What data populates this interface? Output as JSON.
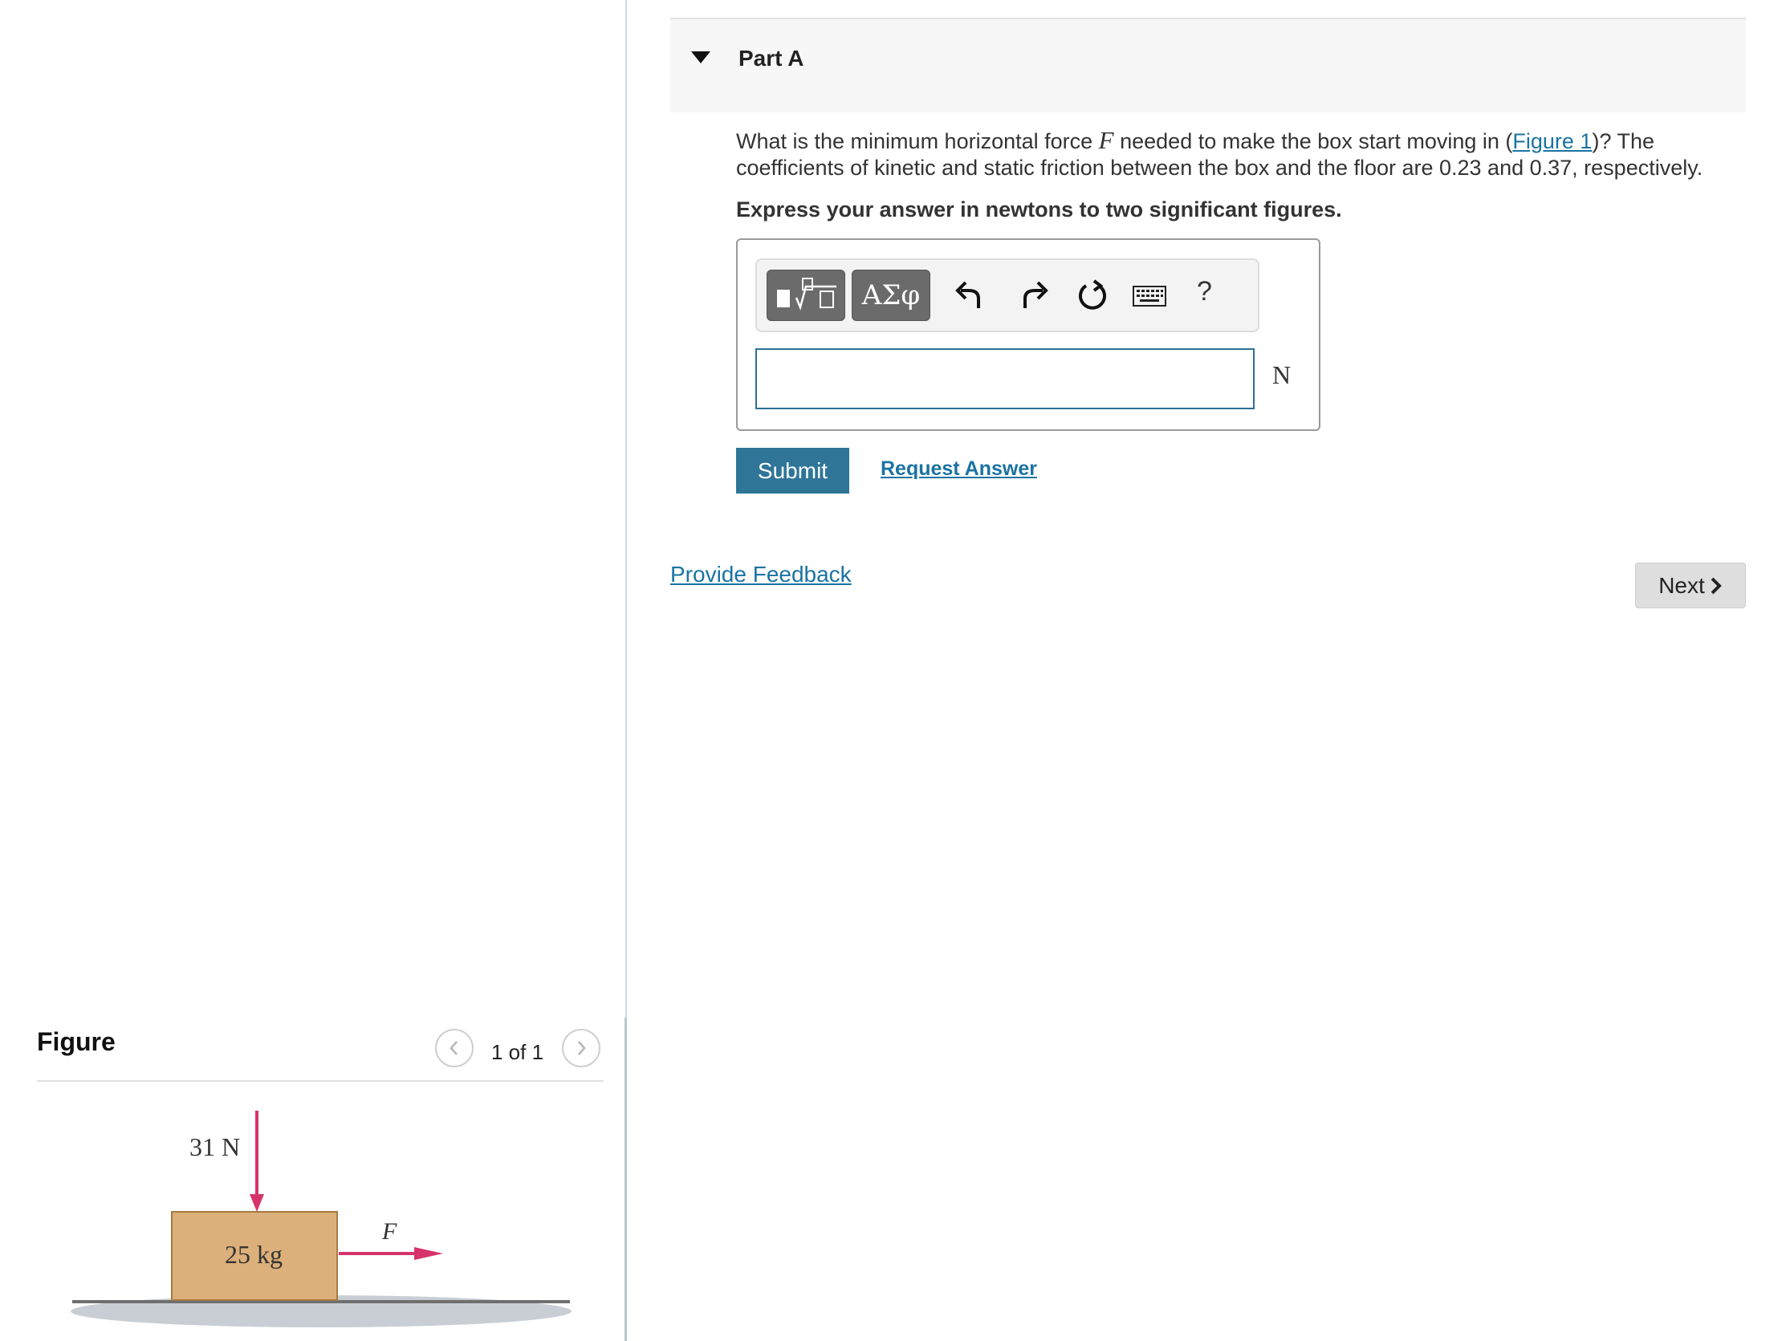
{
  "part": {
    "title": "Part A"
  },
  "question": {
    "text_before": "What is the minimum horizontal force ",
    "variable": "F",
    "text_middle": " needed to make the box start moving in (",
    "figure_link": "Figure 1",
    "text_after": ")? The coefficients of kinetic and static friction between the box and the floor are 0.23 and 0.37, respectively."
  },
  "instruction": "Express your answer in newtons to two significant figures.",
  "toolbar": {
    "symbols_label": "ΑΣφ",
    "help_label": "?",
    "icons": [
      "templates-icon",
      "undo-icon",
      "redo-icon",
      "reset-icon",
      "keyboard-icon"
    ]
  },
  "answer": {
    "value": "",
    "placeholder": "",
    "unit": "N"
  },
  "actions": {
    "submit_label": "Submit",
    "request_answer_label": "Request Answer",
    "provide_feedback_label": "Provide Feedback",
    "next_label": "Next"
  },
  "figure_panel": {
    "title": "Figure",
    "counter": "1 of 1",
    "diagram": {
      "downward_force_label": "31 N",
      "mass_label": "25 kg",
      "horizontal_force_label": "F"
    }
  },
  "colors": {
    "accent": "#2e7598",
    "link": "#1a73a3",
    "arrow": "#d6336c",
    "box": "#dcb07a"
  }
}
